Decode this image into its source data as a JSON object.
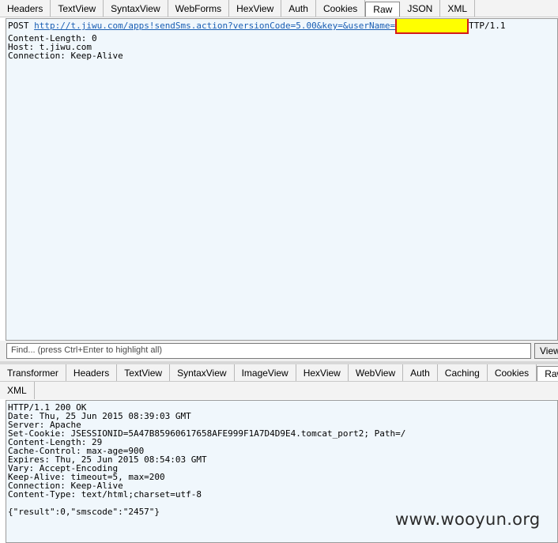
{
  "request_tabs": [
    "Headers",
    "TextView",
    "SyntaxView",
    "WebForms",
    "HexView",
    "Auth",
    "Cookies",
    "Raw",
    "JSON",
    "XML"
  ],
  "request_active_tab": "Raw",
  "request": {
    "method": "POST",
    "url": "http://t.jiwu.com/apps!sendSms.action?versionCode=5.00&key=&userName=",
    "protocol": "TTP/1.1",
    "headers": [
      "Content-Length: 0",
      "Host: t.jiwu.com",
      "Connection: Keep-Alive"
    ]
  },
  "find": {
    "placeholder": "Find... (press Ctrl+Enter to highlight all)",
    "button": "View"
  },
  "response_tabs_row1": [
    "Transformer",
    "Headers",
    "TextView",
    "SyntaxView",
    "ImageView",
    "HexView",
    "WebView",
    "Auth",
    "Caching",
    "Cookies",
    "Raw"
  ],
  "response_tabs_row2": [
    "XML"
  ],
  "response_active_tab": "Raw",
  "response": {
    "lines": [
      "HTTP/1.1 200 OK",
      "Date: Thu, 25 Jun 2015 08:39:03 GMT",
      "Server: Apache",
      "Set-Cookie: JSESSIONID=5A47B85960617658AFE999F1A7D4D9E4.tomcat_port2; Path=/",
      "Content-Length: 29",
      "Cache-Control: max-age=900",
      "Expires: Thu, 25 Jun 2015 08:54:03 GMT",
      "Vary: Accept-Encoding",
      "Keep-Alive: timeout=5, max=200",
      "Connection: Keep-Alive",
      "Content-Type: text/html;charset=utf-8"
    ],
    "body": "{\"result\":0,\"smscode\":\"2457\"}"
  },
  "watermark": "www.wooyun.org",
  "colors": {
    "panel_bg": "#f0f7fc",
    "link": "#1a5fb4",
    "redact_fill": "#ffff00",
    "redact_border": "#d41a1a"
  }
}
